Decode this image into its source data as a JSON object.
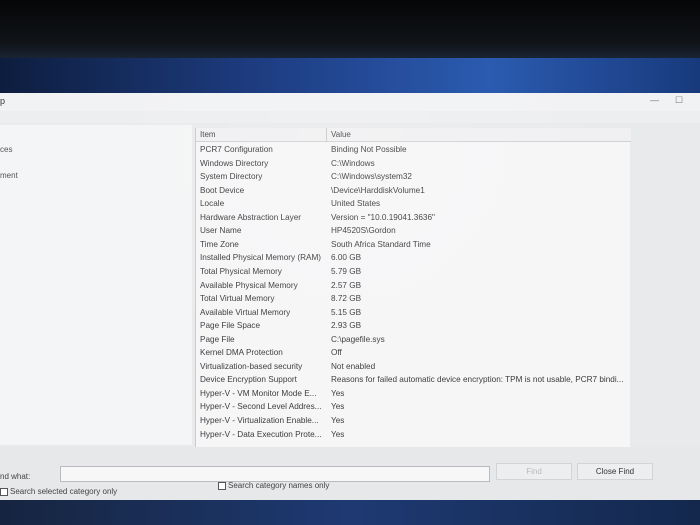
{
  "window": {
    "title_glyph": "p",
    "minimize": "—",
    "maximize": "☐"
  },
  "tree": {
    "items": [
      "ces",
      "ment"
    ]
  },
  "list": {
    "headers": {
      "item": "Item",
      "value": "Value"
    },
    "rows": [
      {
        "item": "PCR7 Configuration",
        "value": "Binding Not Possible"
      },
      {
        "item": "Windows Directory",
        "value": "C:\\Windows"
      },
      {
        "item": "System Directory",
        "value": "C:\\Windows\\system32"
      },
      {
        "item": "Boot Device",
        "value": "\\Device\\HarddiskVolume1"
      },
      {
        "item": "Locale",
        "value": "United States"
      },
      {
        "item": "Hardware Abstraction Layer",
        "value": "Version = \"10.0.19041.3636\""
      },
      {
        "item": "User Name",
        "value": "HP4520S\\Gordon"
      },
      {
        "item": "Time Zone",
        "value": "South Africa Standard Time"
      },
      {
        "item": "Installed Physical Memory (RAM)",
        "value": "6.00 GB"
      },
      {
        "item": "Total Physical Memory",
        "value": "5.79 GB"
      },
      {
        "item": "Available Physical Memory",
        "value": "2.57 GB"
      },
      {
        "item": "Total Virtual Memory",
        "value": "8.72 GB"
      },
      {
        "item": "Available Virtual Memory",
        "value": "5.15 GB"
      },
      {
        "item": "Page File Space",
        "value": "2.93 GB"
      },
      {
        "item": "Page File",
        "value": "C:\\pagefile.sys"
      },
      {
        "item": "Kernel DMA Protection",
        "value": "Off"
      },
      {
        "item": "Virtualization-based security",
        "value": "Not enabled"
      },
      {
        "item": "Device Encryption Support",
        "value": "Reasons for failed automatic device encryption: TPM is not usable, PCR7 bindi..."
      },
      {
        "item": "Hyper-V - VM Monitor Mode E...",
        "value": "Yes"
      },
      {
        "item": "Hyper-V - Second Level Addres...",
        "value": "Yes"
      },
      {
        "item": "Hyper-V - Virtualization Enable...",
        "value": "Yes"
      },
      {
        "item": "Hyper-V - Data Execution Prote...",
        "value": "Yes"
      }
    ]
  },
  "findbar": {
    "label": "nd what:",
    "input_value": "",
    "find_button": "Find",
    "close_button": "Close Find",
    "search_selected": "Search selected category only",
    "search_names": "Search category names only"
  }
}
